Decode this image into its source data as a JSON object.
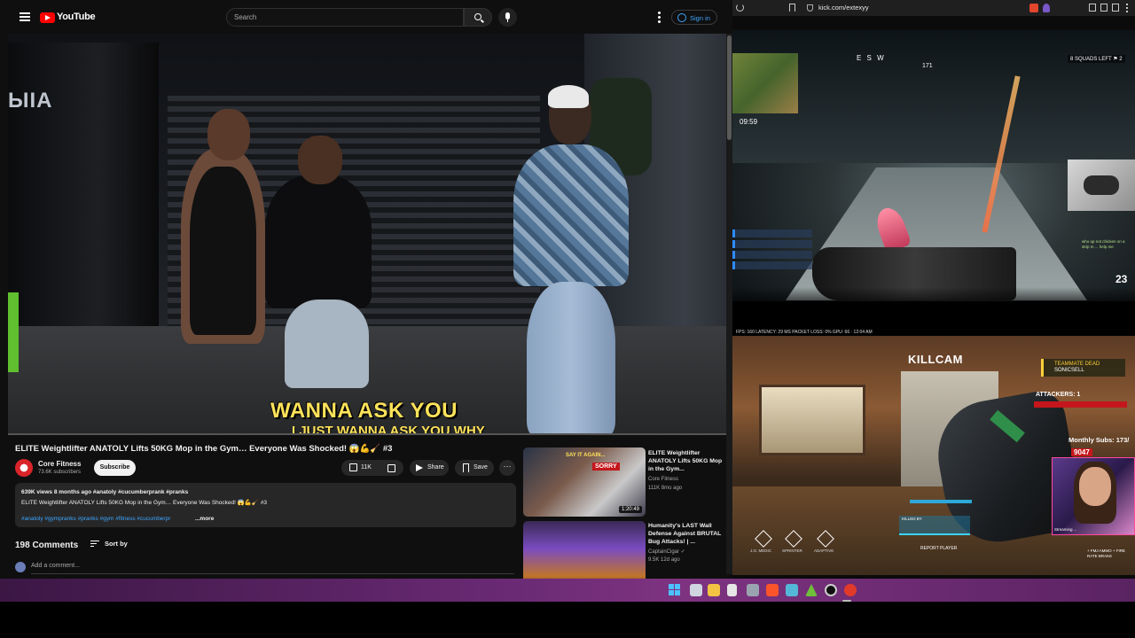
{
  "youtube": {
    "brand": "YouTube",
    "search_placeholder": "Search",
    "signin_label": "Sign in",
    "video": {
      "caption_main": "WANNA ASK YOU",
      "caption_sub": "I JUST WANNA ASK YOU WHY",
      "gym_sign": "ЫIA",
      "progress_fraction": 0.0
    },
    "title": "ELITE Weightlifter ANATOLY Lifts 50KG Mop in the Gym… Everyone Was Shocked! 😱💪🧹 #3",
    "channel": {
      "name": "Core Fitness",
      "subscribers": "73.6K subscribers"
    },
    "subscribe_label": "Subscribe",
    "likes": "11K",
    "share_label": "Share",
    "save_label": "Save",
    "more_label": "···",
    "description": {
      "meta": "639K views  8 months ago  #anatoly #cucumberprank #pranks",
      "line": "ELITE Weightlifter ANATOLY Lifts 50KG Mop in the Gym… Everyone Was Shocked! 😱💪🧹 #3",
      "tags": "#anatoly #gympranks #pranks #gym #fitness #cucumberpr",
      "more": "...more"
    },
    "comments_count": "198 Comments",
    "sort_label": "Sort by",
    "add_comment_placeholder": "Add a comment...",
    "recommended": [
      {
        "title": "ELITE Weightlifter ANATOLY Lifts 50KG Mop in the Gym...",
        "channel": "Core Fitness",
        "meta": "111K  8mo ago",
        "duration": "1:20:49",
        "thumb_tag1": "SAY IT AGAIN...",
        "thumb_tag2": "SORRY"
      },
      {
        "title": "Humanity's LAST Wall Defense Against BRUTAL Bug Attacks! | ...",
        "channel": "CaptainCigar ✓",
        "meta": "9.5K  12d ago",
        "duration": ""
      }
    ]
  },
  "kick": {
    "url": "kick.com/extexyy",
    "game1": {
      "timer": "09:59",
      "compass": "E       S       W",
      "compass_num": "171",
      "squad": "8 SQUADS LEFT  ⚑ 2",
      "ammo": "23",
      "chat": "who up not chicken on a strip m ... help me"
    },
    "stats": "FPS: 160  LATENCY: 29 MS  PACKET LOSS: 0%  GPU: 66  ·  12:04 AM",
    "game2": {
      "killcam": "KILLCAM",
      "teammate_dead": "TEAMMATE DEAD",
      "teammate_name": "SONICSELL",
      "attackers": "ATTACKERS: 1",
      "subs_goal": "Monthly Subs: 173/",
      "subs_count": "9047",
      "webcam_label": "Streaming ...",
      "perks": [
        "J.O. MEDIC",
        "SPRINTER",
        "ADAPTIVE"
      ],
      "killed_by": "KILLED BY",
      "report": "REPORT PLAYER",
      "right_hud": "+ FMJ AMMO + FIRE RATE BRAKE"
    }
  }
}
